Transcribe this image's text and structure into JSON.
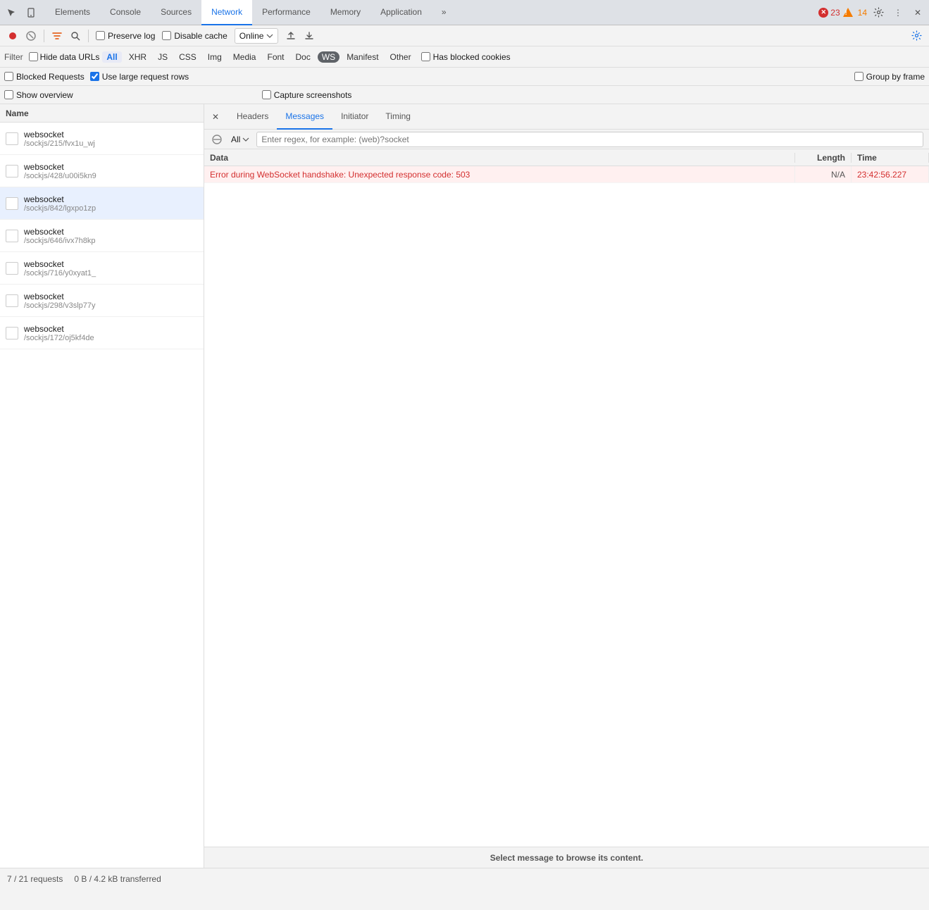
{
  "devtools": {
    "tabs": [
      {
        "label": "Elements",
        "active": false
      },
      {
        "label": "Console",
        "active": false
      },
      {
        "label": "Sources",
        "active": false
      },
      {
        "label": "Network",
        "active": true
      },
      {
        "label": "Performance",
        "active": false
      },
      {
        "label": "Memory",
        "active": false
      },
      {
        "label": "Application",
        "active": false
      },
      {
        "label": "»",
        "active": false
      }
    ],
    "error_count": "23",
    "warn_count": "14"
  },
  "toolbar": {
    "preserve_log_label": "Preserve log",
    "disable_cache_label": "Disable cache",
    "throttle_label": "Online",
    "preserve_log_checked": false,
    "disable_cache_checked": false
  },
  "filter_bar": {
    "label": "Filter",
    "hide_data_urls_label": "Hide data URLs",
    "filter_types": [
      {
        "label": "All",
        "active": true
      },
      {
        "label": "XHR",
        "active": false
      },
      {
        "label": "JS",
        "active": false
      },
      {
        "label": "CSS",
        "active": false
      },
      {
        "label": "Img",
        "active": false
      },
      {
        "label": "Media",
        "active": false
      },
      {
        "label": "Font",
        "active": false
      },
      {
        "label": "Doc",
        "active": false
      },
      {
        "label": "WS",
        "active": false,
        "pill": true
      },
      {
        "label": "Manifest",
        "active": false
      },
      {
        "label": "Other",
        "active": false
      }
    ],
    "has_blocked_cookies_label": "Has blocked cookies",
    "has_blocked_cookies_checked": false
  },
  "options": {
    "blocked_requests_label": "Blocked Requests",
    "blocked_requests_checked": false,
    "use_large_rows_label": "Use large request rows",
    "use_large_rows_checked": true,
    "group_by_frame_label": "Group by frame",
    "group_by_frame_checked": false,
    "show_overview_label": "Show overview",
    "show_overview_checked": false,
    "capture_screenshots_label": "Capture screenshots",
    "capture_screenshots_checked": false
  },
  "name_column": "Name",
  "requests": [
    {
      "name": "websocket",
      "path": "/sockjs/215/fvx1u_wj",
      "selected": false
    },
    {
      "name": "websocket",
      "path": "/sockjs/428/u00i5kn9",
      "selected": false
    },
    {
      "name": "websocket",
      "path": "/sockjs/842/lgxpo1zp",
      "selected": true
    },
    {
      "name": "websocket",
      "path": "/sockjs/646/ivx7h8kp",
      "selected": false
    },
    {
      "name": "websocket",
      "path": "/sockjs/716/y0xyat1_",
      "selected": false
    },
    {
      "name": "websocket",
      "path": "/sockjs/298/v3slp77y",
      "selected": false
    },
    {
      "name": "websocket",
      "path": "/sockjs/172/oj5kf4de",
      "selected": false
    }
  ],
  "panel_tabs": [
    {
      "label": "Headers",
      "active": false
    },
    {
      "label": "Messages",
      "active": true
    },
    {
      "label": "Initiator",
      "active": false
    },
    {
      "label": "Timing",
      "active": false
    }
  ],
  "messages_filter": {
    "dropdown_label": "All",
    "regex_placeholder": "Enter regex, for example: (web)?socket"
  },
  "messages_columns": {
    "data": "Data",
    "length": "Length",
    "time": "Time"
  },
  "messages_rows": [
    {
      "data": "Error during WebSocket handshake: Unexpected response code: 503",
      "length": "N/A",
      "time": "23:42:56.227",
      "error": true
    }
  ],
  "status_bar": {
    "requests": "7 / 21 requests",
    "transferred": "0 B / 4.2 kB transferred"
  },
  "select_message": "Select message to browse its content."
}
